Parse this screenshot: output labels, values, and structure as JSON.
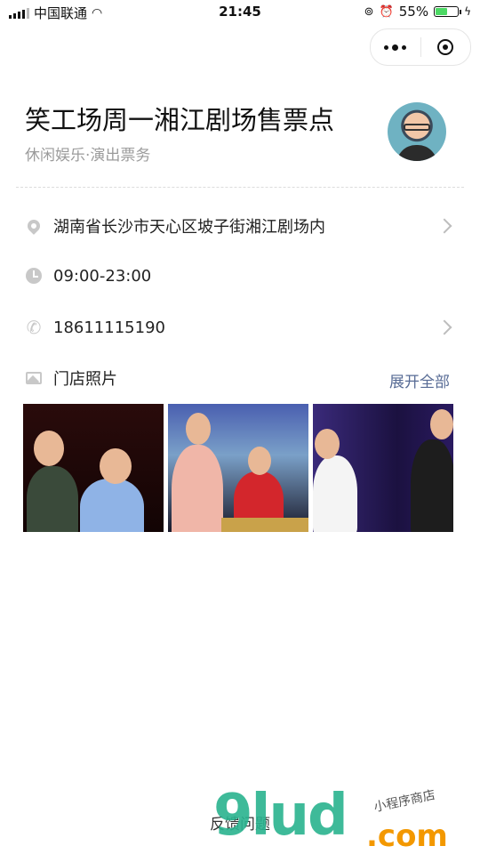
{
  "status_bar": {
    "carrier": "中国联通",
    "time": "21:45",
    "battery": "55%",
    "battery_level": 0.55
  },
  "store": {
    "title": "笑工场周一湘江剧场售票点",
    "category": "休闲娱乐·演出票务"
  },
  "info": {
    "address": "湖南省长沙市天心区坡子街湘江剧场内",
    "hours": "09:00-23:00",
    "phone": "18611115190",
    "photos_label": "门店照片",
    "expand_label": "展开全部"
  },
  "footer": {
    "feedback": "反馈问题"
  },
  "watermark": {
    "brand": "9lud",
    "suffix": ".com",
    "tagline": "小程序商店"
  },
  "icons": {
    "address": "location-pin-icon",
    "hours": "clock-icon",
    "phone": "phone-icon",
    "photos": "image-icon"
  },
  "colors": {
    "link": "#576b95",
    "muted": "#9b9b9b",
    "battery": "#4cd964"
  }
}
